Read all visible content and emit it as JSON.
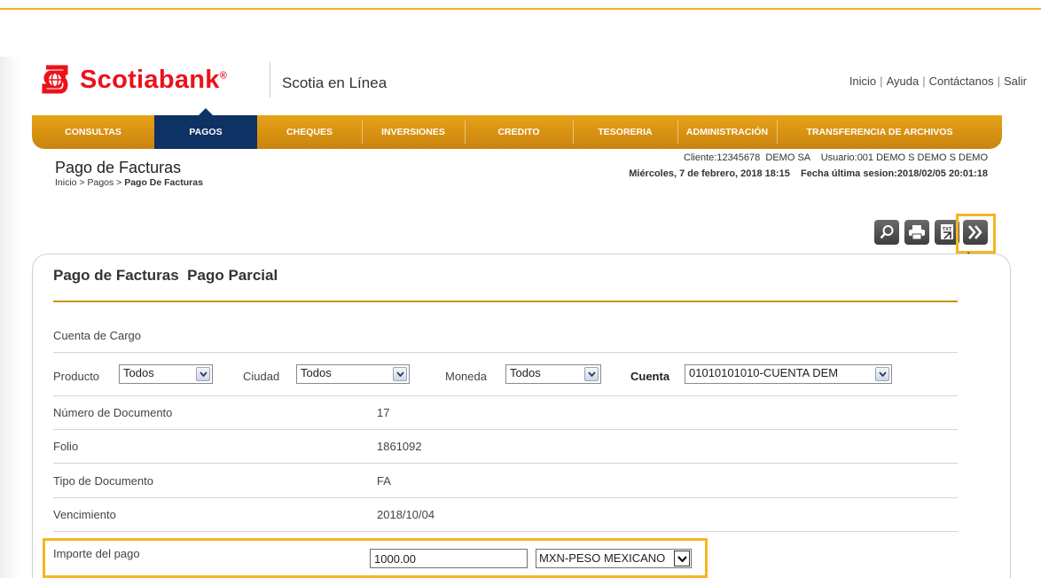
{
  "header": {
    "brand": "Scotiabank",
    "brand_mark": "®",
    "app_name": "Scotia en Línea",
    "links": [
      "Inicio",
      "Ayuda",
      "Contáctanos",
      "Salir"
    ]
  },
  "nav": {
    "items": [
      "CONSULTAS",
      "PAGOS",
      "CHEQUES",
      "INVERSIONES",
      "CREDITO",
      "TESORERIA",
      "ADMINISTRACIÓN",
      "TRANSFERENCIA DE ARCHIVOS"
    ],
    "active": "PAGOS"
  },
  "page": {
    "title": "Pago de Facturas",
    "breadcrumb_prefix": "Inicio > Pagos > ",
    "breadcrumb_current": "Pago De Facturas",
    "client_info": "Cliente:12345678  DEMO SA    Usuario:001 DEMO S DEMO S DEMO",
    "date_info": "Miércoles, 7 de febrero, 2018 18:15    Fecha última sesion:2018/02/05 20:01:18"
  },
  "toolbar": {
    "icons": [
      "search-icon",
      "print-icon",
      "txt-export-icon",
      "next-icon"
    ],
    "txt_label": "TXT"
  },
  "form": {
    "panel_title": "Pago de Facturas  Pago Parcial",
    "account_section": "Cuenta de Cargo",
    "filters": {
      "producto_label": "Producto",
      "producto_value": "Todos",
      "ciudad_label": "Ciudad",
      "ciudad_value": "Todos",
      "moneda_label": "Moneda",
      "moneda_value": "Todos",
      "cuenta_label": "Cuenta",
      "cuenta_value": "01010101010-CUENTA DEM"
    },
    "rows": [
      {
        "label": "Número de Documento",
        "value": "17"
      },
      {
        "label": "Folio",
        "value": "1861092"
      },
      {
        "label": "Tipo de Documento",
        "value": "FA"
      },
      {
        "label": "Vencimiento",
        "value": "2018/10/04"
      }
    ],
    "amount": {
      "label": "Importe del pago",
      "value": "1000.00",
      "currency": "MXN-PESO MEXICANO"
    }
  },
  "colors": {
    "brand_red": "#ec111a",
    "nav_gold": "#e09a16",
    "nav_active": "#0e3263",
    "highlight": "#f5b622"
  }
}
